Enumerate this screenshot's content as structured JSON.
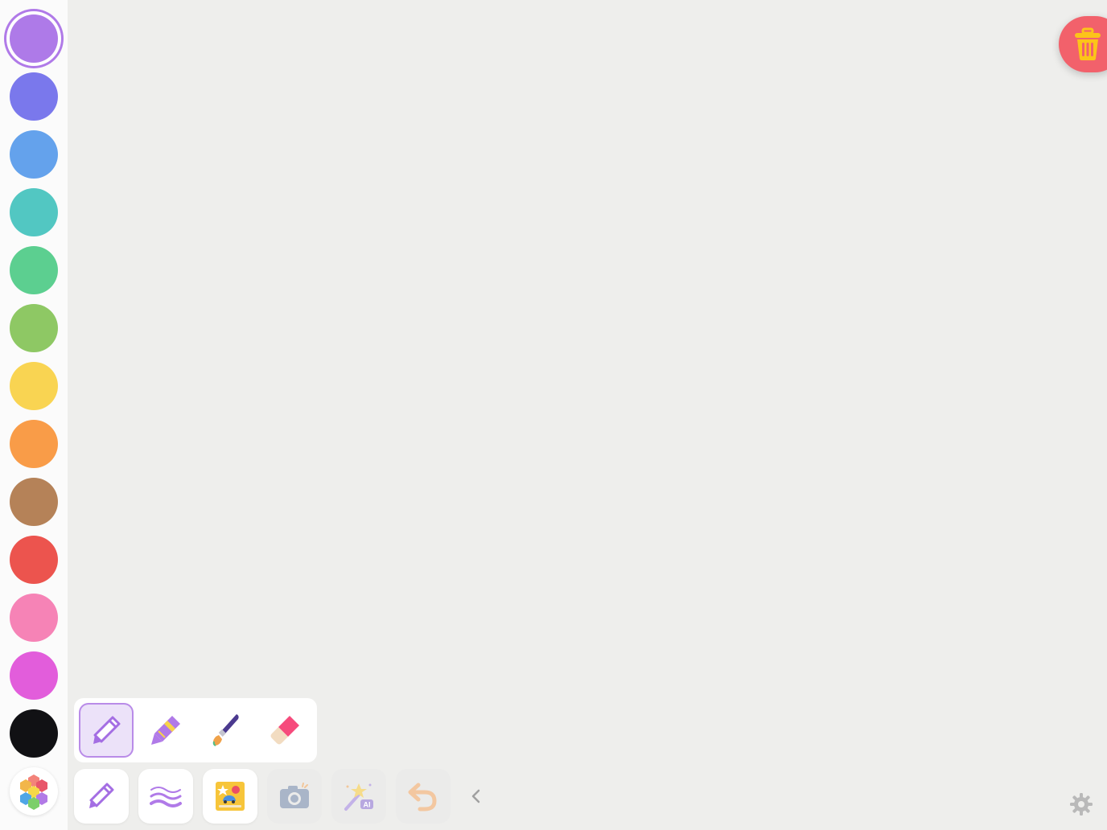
{
  "palette": {
    "selected_color": "#ae7ae8",
    "colors": [
      {
        "name": "purple",
        "hex": "#ae7ae8",
        "selected": true
      },
      {
        "name": "indigo",
        "hex": "#7a78ec",
        "selected": false
      },
      {
        "name": "blue",
        "hex": "#64a2ec",
        "selected": false
      },
      {
        "name": "teal",
        "hex": "#52c7c2",
        "selected": false
      },
      {
        "name": "green",
        "hex": "#5ccf90",
        "selected": false
      },
      {
        "name": "lime",
        "hex": "#8ec864",
        "selected": false
      },
      {
        "name": "yellow",
        "hex": "#f9d452",
        "selected": false
      },
      {
        "name": "orange",
        "hex": "#f99c48",
        "selected": false
      },
      {
        "name": "brown",
        "hex": "#b58258",
        "selected": false
      },
      {
        "name": "red",
        "hex": "#ec544e",
        "selected": false
      },
      {
        "name": "pink",
        "hex": "#f683b6",
        "selected": false
      },
      {
        "name": "magenta",
        "hex": "#e25ddb",
        "selected": false
      },
      {
        "name": "black",
        "hex": "#111114",
        "selected": false
      }
    ],
    "more_colors_icon": "color-hexagons-icon"
  },
  "brush_tray": {
    "active": "pen",
    "brushes": [
      {
        "id": "pen",
        "icon": "pen-icon"
      },
      {
        "id": "crayon",
        "icon": "crayon-icon"
      },
      {
        "id": "paintbrush",
        "icon": "paintbrush-icon"
      },
      {
        "id": "eraser",
        "icon": "eraser-icon"
      }
    ]
  },
  "toolbar": {
    "tools": [
      {
        "id": "brush",
        "icon": "pen-icon",
        "enabled": true
      },
      {
        "id": "stroke-width",
        "icon": "wavy-lines-icon",
        "enabled": true
      },
      {
        "id": "stickers",
        "icon": "sticker-book-icon",
        "enabled": true
      },
      {
        "id": "camera",
        "icon": "camera-icon",
        "enabled": false
      },
      {
        "id": "ai-magic",
        "icon": "magic-wand-ai-icon",
        "enabled": false
      },
      {
        "id": "undo",
        "icon": "undo-arrow-icon",
        "enabled": false
      }
    ]
  },
  "trash": {
    "icon": "trash-icon",
    "bg": "#f2616b",
    "icon_color": "#fcc419"
  },
  "settings": {
    "icon": "gear-icon"
  }
}
